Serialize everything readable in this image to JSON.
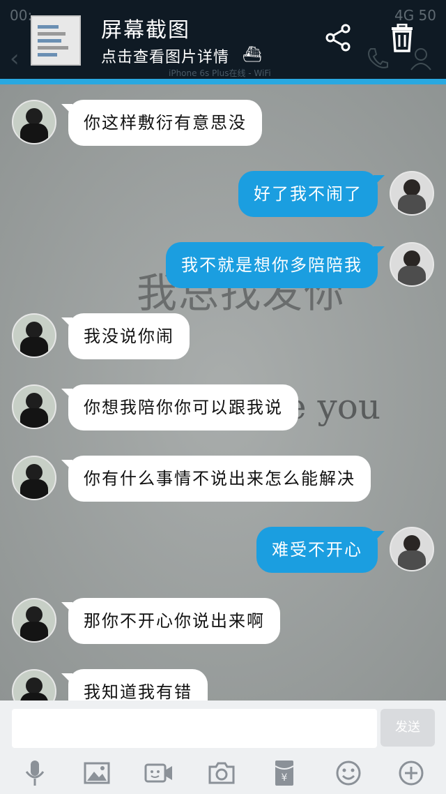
{
  "status": {
    "time": "00:",
    "right": "4G  50"
  },
  "header": {
    "title": "屏幕截图",
    "subtitle": "点击查看图片详情",
    "online": "iPhone 6s Plus在线 - WiFi"
  },
  "watermark": {
    "line1": "我总找发你",
    "line2": "e you"
  },
  "messages": [
    {
      "side": "left",
      "text": "你这样敷衍有意思没"
    },
    {
      "side": "right",
      "text": "好了我不闹了"
    },
    {
      "side": "right",
      "text": "我不就是想你多陪陪我"
    },
    {
      "side": "left",
      "text": "我没说你闹"
    },
    {
      "side": "left",
      "text": "你想我陪你你可以跟我说"
    },
    {
      "side": "left",
      "text": "你有什么事情不说出来怎么能解决"
    },
    {
      "side": "right",
      "text": "难受不开心"
    },
    {
      "side": "left",
      "text": "那你不开心你说出来啊"
    },
    {
      "side": "left",
      "text": "我知道我有错"
    }
  ],
  "input": {
    "send_label": "发送",
    "placeholder": ""
  },
  "toolbar_icons": [
    "microphone-icon",
    "image-icon",
    "video-icon",
    "camera-icon",
    "red-packet-icon",
    "emoji-icon",
    "plus-icon"
  ],
  "colors": {
    "header_bg": "#0f1a24",
    "accent": "#29a8e0",
    "bubble_out": "#1b9ee0",
    "bubble_in": "#ffffff"
  }
}
